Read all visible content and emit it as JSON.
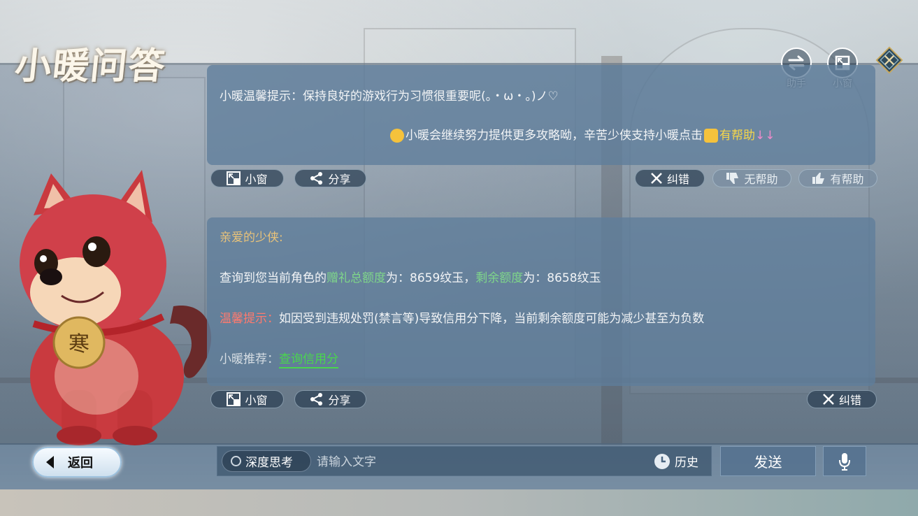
{
  "header": {
    "title": "小暖问答",
    "switch_label": "助手",
    "window_label": "小窗"
  },
  "card1": {
    "tip_text": "小暖温馨提示：保持良好的游戏行为习惯很重要呢(。・ω・。)ノ♡",
    "thanks_text": "小暖会继续努力提供更多攻略呦，辛苦少侠支持小暖点击",
    "helpful_inline": "有帮助",
    "arrows": "↓↓"
  },
  "card1_actions": {
    "window_label": "小窗",
    "share_label": "分享",
    "correct_label": "纠错",
    "unhelpful_label": "无帮助",
    "helpful_label": "有帮助"
  },
  "card2": {
    "greeting": "亲爱的少侠:",
    "query_prefix": "查询到您当前角色的",
    "gift_total_label": "赠礼总额度",
    "gift_total_value": "为：8659纹玉，",
    "remaining_label": "剩余额度",
    "remaining_value": "为：8658纹玉",
    "warm_tip_label": "温馨提示：",
    "warm_tip_text": "如因受到违规处罚(禁言等)导致信用分下降，当前剩余额度可能为减少甚至为负数",
    "recommend_label": "小暖推荐：",
    "recommend_link": "查询信用分"
  },
  "card2_actions": {
    "window_label": "小窗",
    "share_label": "分享",
    "correct_label": "纠错"
  },
  "footer": {
    "back_label": "返回",
    "deep_think_label": "深度思考",
    "input_placeholder": "请输入文字",
    "history_label": "历史",
    "send_label": "发送"
  },
  "pet_tag": "寒",
  "colors": {
    "gold": "#e8c27a",
    "green": "#7fd68a",
    "red": "#ff7a6e",
    "link_green": "#49d64d",
    "yellow": "#f5d64a",
    "pink": "#f08acb"
  }
}
